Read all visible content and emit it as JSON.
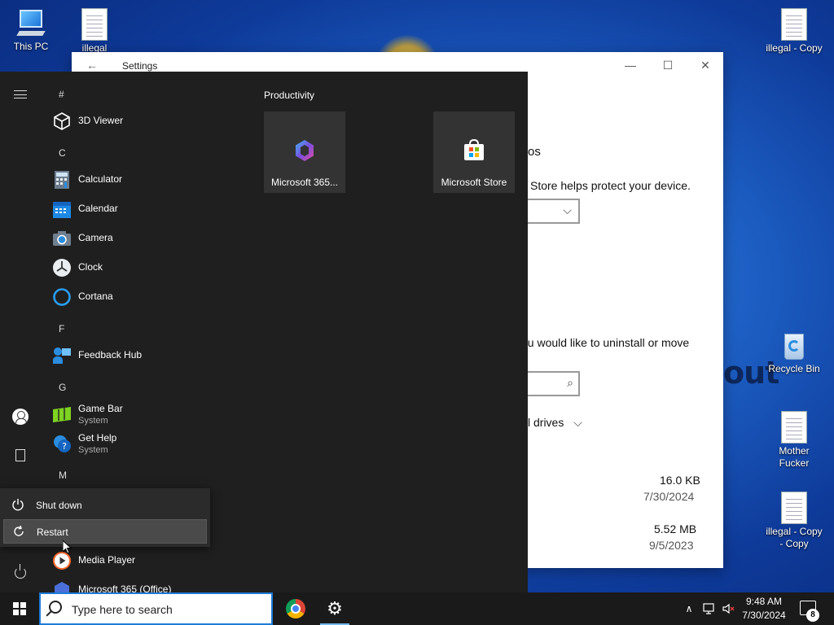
{
  "desktop": {
    "icons": {
      "this_pc": "This PC",
      "illegal_top": "illegal",
      "illegal_copy": "illegal - Copy",
      "recycle_bin": "Recycle Bin",
      "mother": "Mother Fucker",
      "illegal_copy_copy": "illegal - Copy - Copy"
    },
    "wallpaper_text": "out"
  },
  "settings": {
    "title": "Settings",
    "fragment_os": "os",
    "store_text": "Store helps protect your device.",
    "uninstall_text": "ou would like to uninstall or move",
    "drives_text": "l drives",
    "file1_size": "16.0 KB",
    "file1_date": "7/30/2024",
    "file2_size": "5.52 MB",
    "file2_date": "9/5/2023"
  },
  "start_menu": {
    "letters": {
      "hash": "#",
      "c": "C",
      "f": "F",
      "g": "G",
      "m": "M"
    },
    "apps": {
      "viewer3d": "3D Viewer",
      "calculator": "Calculator",
      "calendar": "Calendar",
      "camera": "Camera",
      "clock": "Clock",
      "cortana": "Cortana",
      "feedback": "Feedback Hub",
      "gamebar": "Game Bar",
      "gamebar_sub": "System",
      "gethelp": "Get Help",
      "gethelp_sub": "System",
      "mediaplayer": "Media Player",
      "m365": "Microsoft 365 (Office)"
    },
    "tiles_group": "Productivity",
    "tiles": {
      "m365": "Microsoft 365...",
      "store": "Microsoft Store"
    },
    "power_menu": {
      "shutdown": "Shut down",
      "restart": "Restart"
    }
  },
  "taskbar": {
    "search_placeholder": "Type here to search",
    "time": "9:48 AM",
    "date": "7/30/2024",
    "notification_count": "8"
  },
  "colors": {
    "accent": "#1e7bd6",
    "start_bg": "#1f1f1f",
    "tile_bg": "#333333"
  }
}
